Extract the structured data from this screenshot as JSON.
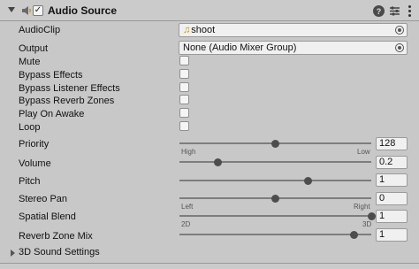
{
  "component": {
    "title": "Audio Source",
    "enabled_mark": "✓",
    "help_glyph": "?"
  },
  "fields": {
    "audio_clip": {
      "label": "AudioClip",
      "value": "shoot"
    },
    "output": {
      "label": "Output",
      "value": "None (Audio Mixer Group)"
    },
    "mute": {
      "label": "Mute",
      "checked": false
    },
    "bypass_effects": {
      "label": "Bypass Effects",
      "checked": false
    },
    "bypass_listener_effects": {
      "label": "Bypass Listener Effects",
      "checked": false
    },
    "bypass_reverb_zones": {
      "label": "Bypass Reverb Zones",
      "checked": false
    },
    "play_on_awake": {
      "label": "Play On Awake",
      "checked": false
    },
    "loop": {
      "label": "Loop",
      "checked": false
    }
  },
  "sliders": {
    "priority": {
      "label": "Priority",
      "value": "128",
      "level": 0.5,
      "min_label": "High",
      "max_label": "Low"
    },
    "volume": {
      "label": "Volume",
      "value": "0.2",
      "level": 0.2
    },
    "pitch": {
      "label": "Pitch",
      "value": "1",
      "level": 0.67
    },
    "stereo_pan": {
      "label": "Stereo Pan",
      "value": "0",
      "level": 0.5,
      "min_label": "Left",
      "max_label": "Right"
    },
    "spatial_blend": {
      "label": "Spatial Blend",
      "value": "1",
      "level": 1.0,
      "min_label": "2D",
      "max_label": "3D"
    },
    "reverb_zone_mix": {
      "label": "Reverb Zone Mix",
      "value": "1",
      "level": 0.91
    }
  },
  "sections": {
    "sound_3d": {
      "label": "3D Sound Settings"
    }
  },
  "colors": {
    "panel_bg": "#c8c8c8",
    "header_bg": "#cbcbcb",
    "clip_icon": "#c49000"
  }
}
